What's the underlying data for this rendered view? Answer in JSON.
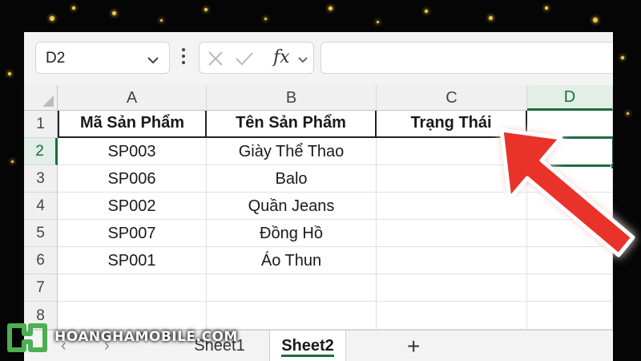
{
  "formula_bar": {
    "name_box": "D2",
    "fx_label": "fx",
    "formula_value": ""
  },
  "columns": [
    "A",
    "B",
    "C",
    "D"
  ],
  "rows": [
    "1",
    "2",
    "3",
    "4",
    "5",
    "6",
    "7",
    "8"
  ],
  "table": {
    "headers": [
      "Mã Sản Phẩm",
      "Tên Sản Phẩm",
      "Trạng Thái"
    ],
    "data": [
      [
        "SP003",
        "Giày Thể Thao",
        ""
      ],
      [
        "SP006",
        "Balo",
        ""
      ],
      [
        "SP002",
        "Quần Jeans",
        ""
      ],
      [
        "SP007",
        "Đồng Hồ",
        ""
      ],
      [
        "SP001",
        "Áo Thun",
        ""
      ]
    ]
  },
  "sheet_tabs": {
    "tabs": [
      "Sheet1",
      "Sheet2"
    ],
    "active": "Sheet2",
    "add_label": "+"
  },
  "logo": {
    "text": "HOANGHAMOBILE.COM"
  },
  "colors": {
    "excel_green": "#1e6b41",
    "annotation_arrow": "#e8322a",
    "sparkle": "#f2c94c"
  },
  "icons": [
    "chevron-down-icon",
    "more-vertical-icon",
    "cancel-icon",
    "enter-check-icon",
    "function-icon",
    "add-sheet-icon",
    "annotation-arrow-icon"
  ]
}
